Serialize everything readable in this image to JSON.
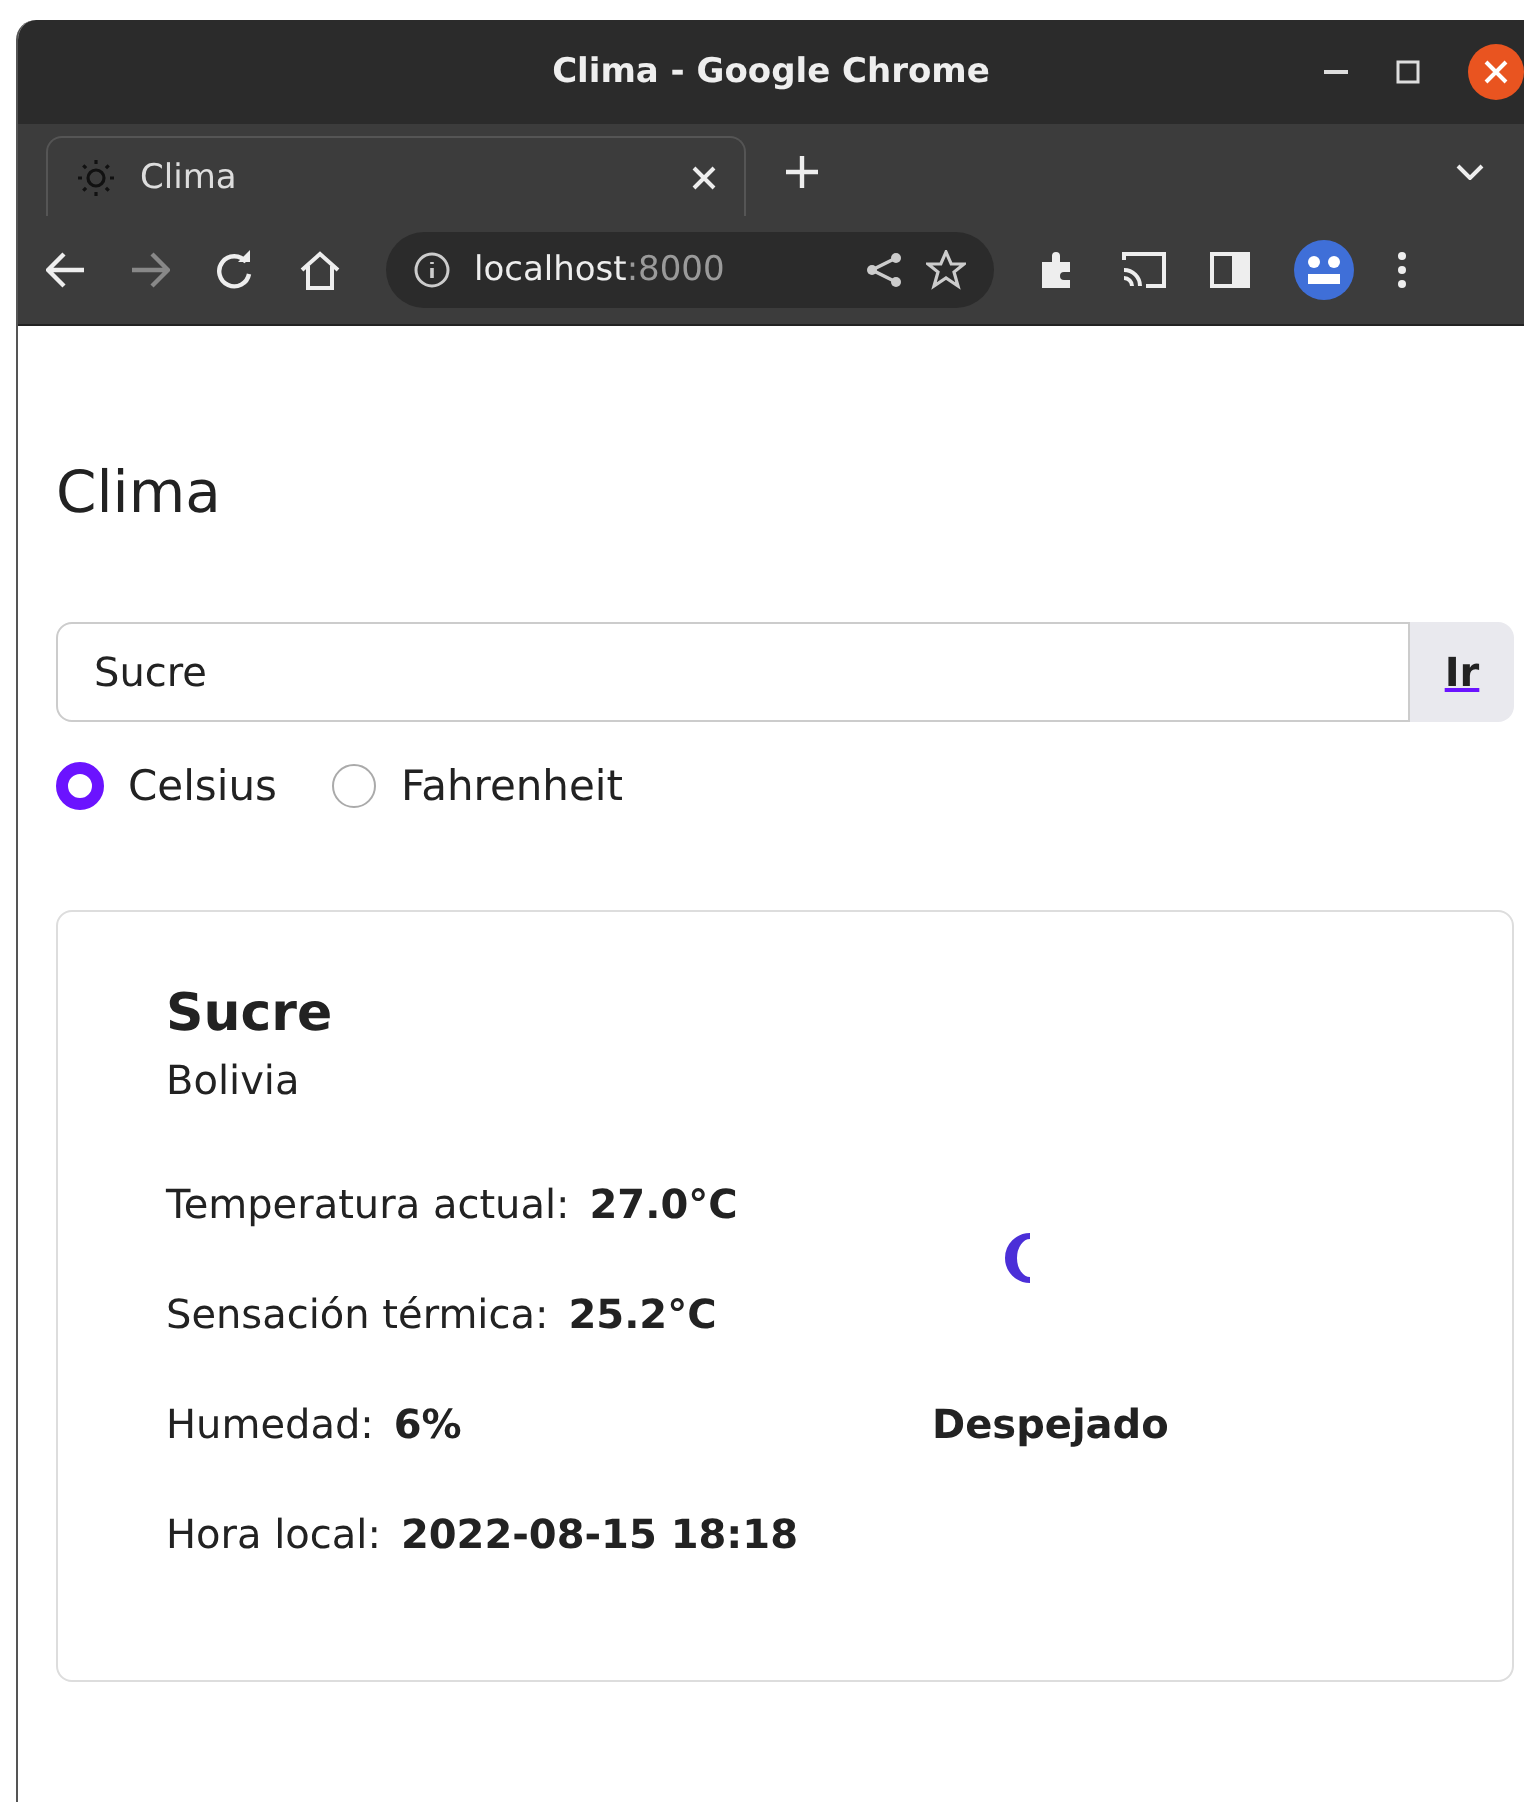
{
  "window": {
    "title": "Clima - Google Chrome"
  },
  "tabs": [
    {
      "label": "Clima",
      "selected": true
    }
  ],
  "address_bar": {
    "host": "localhost",
    "port": ":8000"
  },
  "page": {
    "title": "Clima",
    "search": {
      "value": "Sucre",
      "button": "Ir"
    },
    "units": [
      {
        "label": "Celsius",
        "selected": true
      },
      {
        "label": "Fahrenheit",
        "selected": false
      }
    ],
    "card": {
      "city": "Sucre",
      "country": "Bolivia",
      "rows": [
        {
          "label": "Temperatura actual:",
          "value": "27.0°C"
        },
        {
          "label": "Sensación térmica:",
          "value": "25.2°C"
        },
        {
          "label": "Humedad:",
          "value": "6%"
        },
        {
          "label": "Hora local:",
          "value": "2022-08-15 18:18"
        }
      ],
      "condition": "Despejado"
    }
  }
}
